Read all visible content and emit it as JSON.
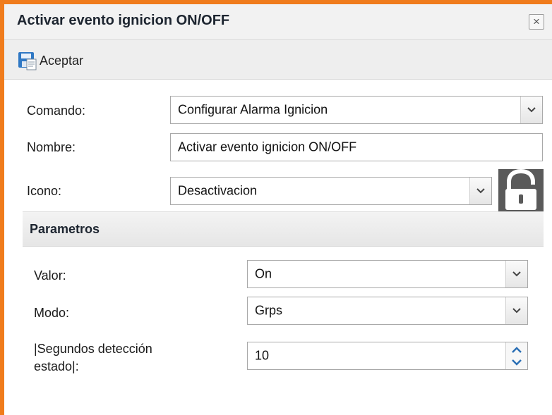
{
  "window": {
    "title": "Activar evento ignicion ON/OFF",
    "close_glyph": "×"
  },
  "toolbar": {
    "accept_label": "Aceptar",
    "accept_icon": "save-disk-icon"
  },
  "form": {
    "comando": {
      "label": "Comando:",
      "value": "Configurar Alarma Ignicion"
    },
    "nombre": {
      "label": "Nombre:",
      "value": "Activar evento ignicion ON/OFF"
    },
    "icono": {
      "label": "Icono:",
      "value": "Desactivacion",
      "preview_icon": "padlock-open-icon"
    }
  },
  "parametros": {
    "title": "Parametros",
    "valor": {
      "label": "Valor:",
      "value": "On"
    },
    "modo": {
      "label": "Modo:",
      "value": "Grps"
    },
    "segundos": {
      "label_line1": "|Segundos detección",
      "label_line2": "estado|:",
      "value": "10"
    }
  },
  "colors": {
    "frame_accent": "#f07c1c",
    "spinner_arrow": "#2a6fb5"
  }
}
